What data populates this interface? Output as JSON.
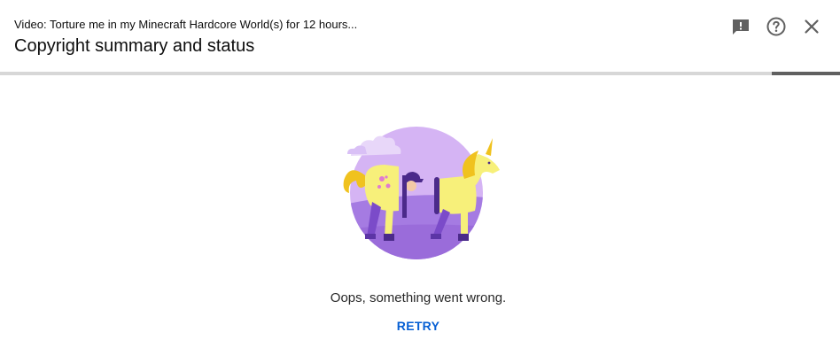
{
  "header": {
    "subtitle": "Video: Torture me in my Minecraft Hardcore World(s) for 12 hours...",
    "title": "Copyright summary and status",
    "actions": [
      {
        "icon": "feedback-icon"
      },
      {
        "icon": "help-icon"
      },
      {
        "icon": "close-icon"
      }
    ]
  },
  "error": {
    "illustration": "split-unicorn-illustration",
    "message": "Oops, something went wrong.",
    "retry_label": "RETRY"
  },
  "colors": {
    "text_primary": "#0d0d0d",
    "icon": "#606060",
    "link_blue": "#065fd4",
    "progress_track": "#d7d7d7",
    "progress_indicator": "#606060",
    "illustration_purple": "#a87be0",
    "illustration_yellow": "#f7f07a"
  }
}
